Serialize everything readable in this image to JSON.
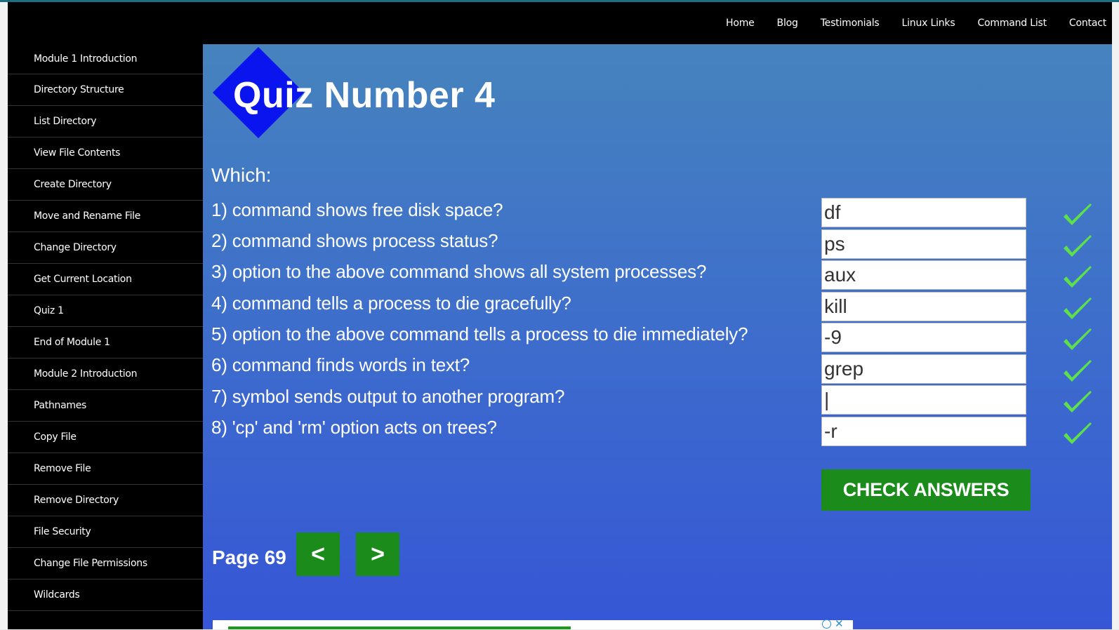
{
  "nav": {
    "items": [
      "Home",
      "Blog",
      "Testimonials",
      "Linux Links",
      "Command List",
      "Contact"
    ]
  },
  "sidebar": {
    "items": [
      "Module 1 Introduction",
      "Directory Structure",
      "List Directory",
      "View File Contents",
      "Create Directory",
      "Move and Rename File",
      "Change Directory",
      "Get Current Location",
      "Quiz 1",
      "End of Module 1",
      "Module 2 Introduction",
      "Pathnames",
      "Copy File",
      "Remove File",
      "Remove Directory",
      "File Security",
      "Change File Permissions",
      "Wildcards"
    ]
  },
  "quiz": {
    "title": "Quiz Number 4",
    "prompt": "Which:",
    "questions": [
      {
        "text": "1) command shows free disk space?",
        "answer": "df"
      },
      {
        "text": "2) command shows process status?",
        "answer": "ps"
      },
      {
        "text": "3) option to the above command shows all system processes?",
        "answer": "aux"
      },
      {
        "text": "4) command tells a process to die gracefully?",
        "answer": "kill"
      },
      {
        "text": "5) option to the above command tells a process to die immediately?",
        "answer": "-9"
      },
      {
        "text": "6) command finds words in text?",
        "answer": "grep"
      },
      {
        "text": "7) symbol sends output to another program?",
        "answer": "|"
      },
      {
        "text": "8) 'cp' and 'rm' option acts on trees?",
        "answer": "-r"
      }
    ],
    "check_label": "CHECK ANSWERS"
  },
  "pager": {
    "page_label": "Page 69",
    "prev_label": "<",
    "next_label": ">"
  },
  "colors": {
    "accent_green": "#1b8c1b",
    "check_green": "#5ee04a",
    "diamond_blue": "#0a14ee"
  },
  "icons": {
    "correct": "checkmark-icon",
    "ad_info": "info-icon",
    "ad_close": "close-icon"
  }
}
